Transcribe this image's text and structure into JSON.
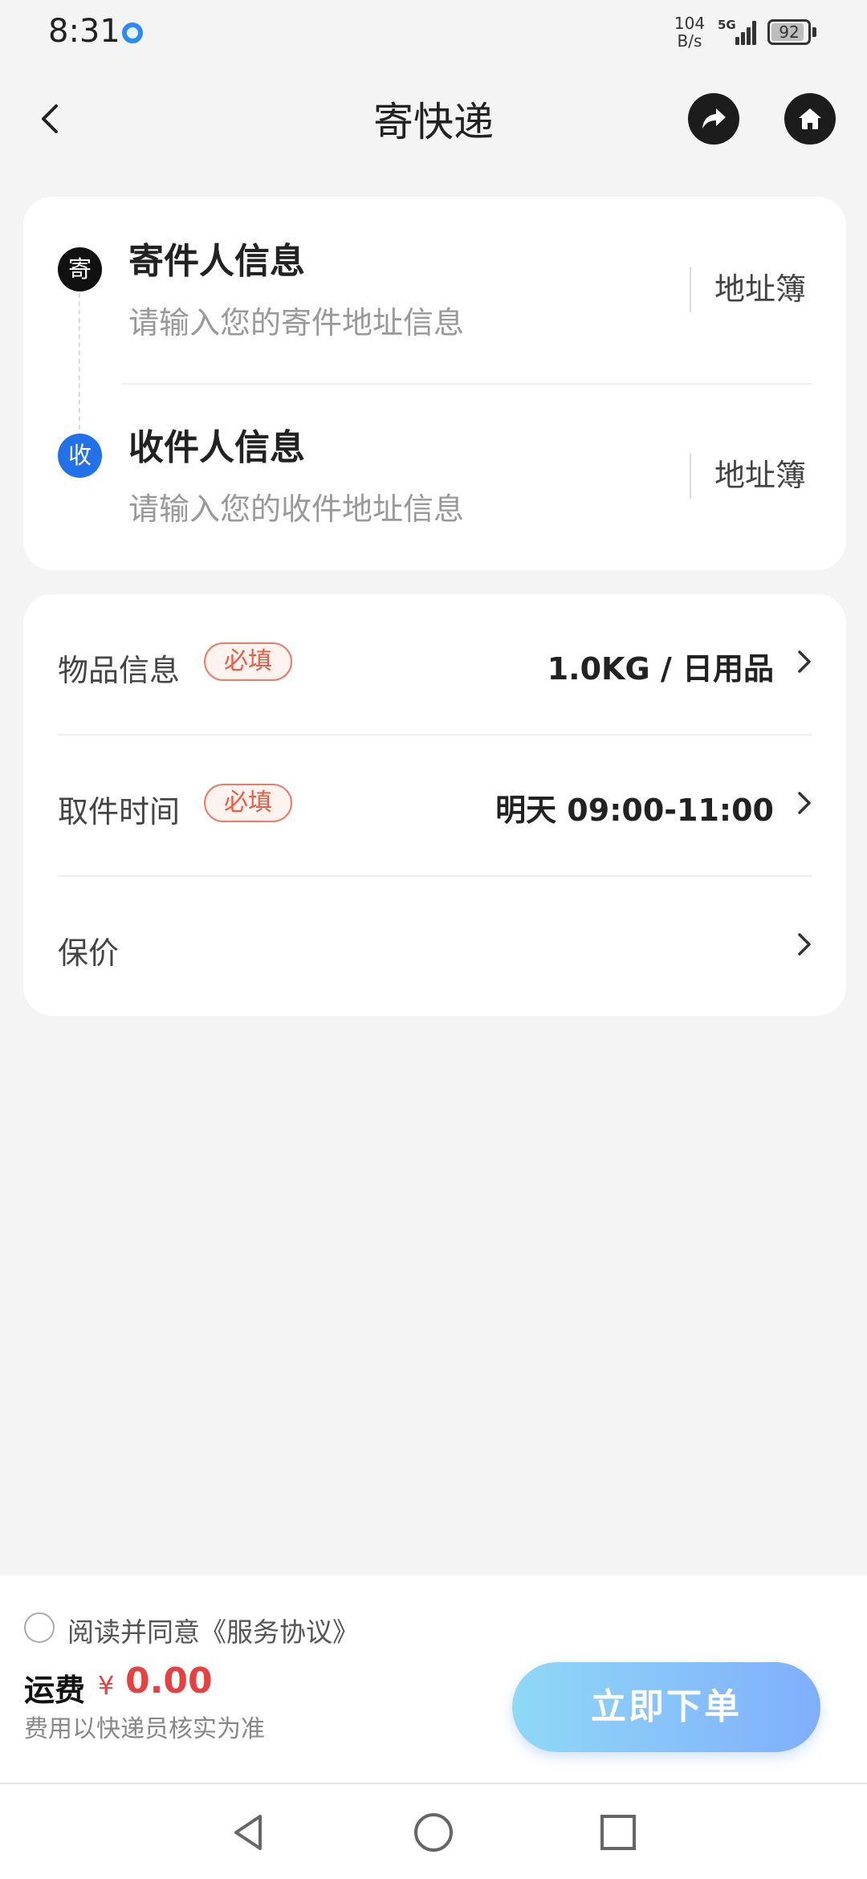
{
  "status_bar": {
    "time": "8:31",
    "net_speed_value": "104",
    "net_speed_unit": "B/s",
    "network_type": "5G",
    "battery": "92"
  },
  "header": {
    "title": "寄快递",
    "icons": [
      "back-arrow-icon",
      "share-icon",
      "home-icon"
    ]
  },
  "sender": {
    "badge": "寄",
    "title": "寄件人信息",
    "placeholder": "请输入您的寄件地址信息",
    "address_book": "地址簿"
  },
  "receiver": {
    "badge": "收",
    "title": "收件人信息",
    "placeholder": "请输入您的收件地址信息",
    "address_book": "地址簿"
  },
  "info": {
    "item": {
      "label": "物品信息",
      "tag": "必填",
      "value": "1.0KG / 日用品"
    },
    "pickup": {
      "label": "取件时间",
      "tag": "必填",
      "value": "明天 09:00-11:00"
    },
    "insurance": {
      "label": "保价"
    }
  },
  "footer": {
    "agreement": "阅读并同意《服务协议》",
    "agreement_checked": false,
    "fee_label": "运费",
    "fee_symbol": "¥",
    "fee_amount": "0.00",
    "fee_note": "费用以快递员核实为准",
    "order_button": "立即下单"
  },
  "colors": {
    "accent_blue": "#2271e8",
    "price_red": "#e84040",
    "required_tag": "#ee5a42",
    "button_gradient_start": "#8fd8f6",
    "button_gradient_end": "#80aefc"
  }
}
